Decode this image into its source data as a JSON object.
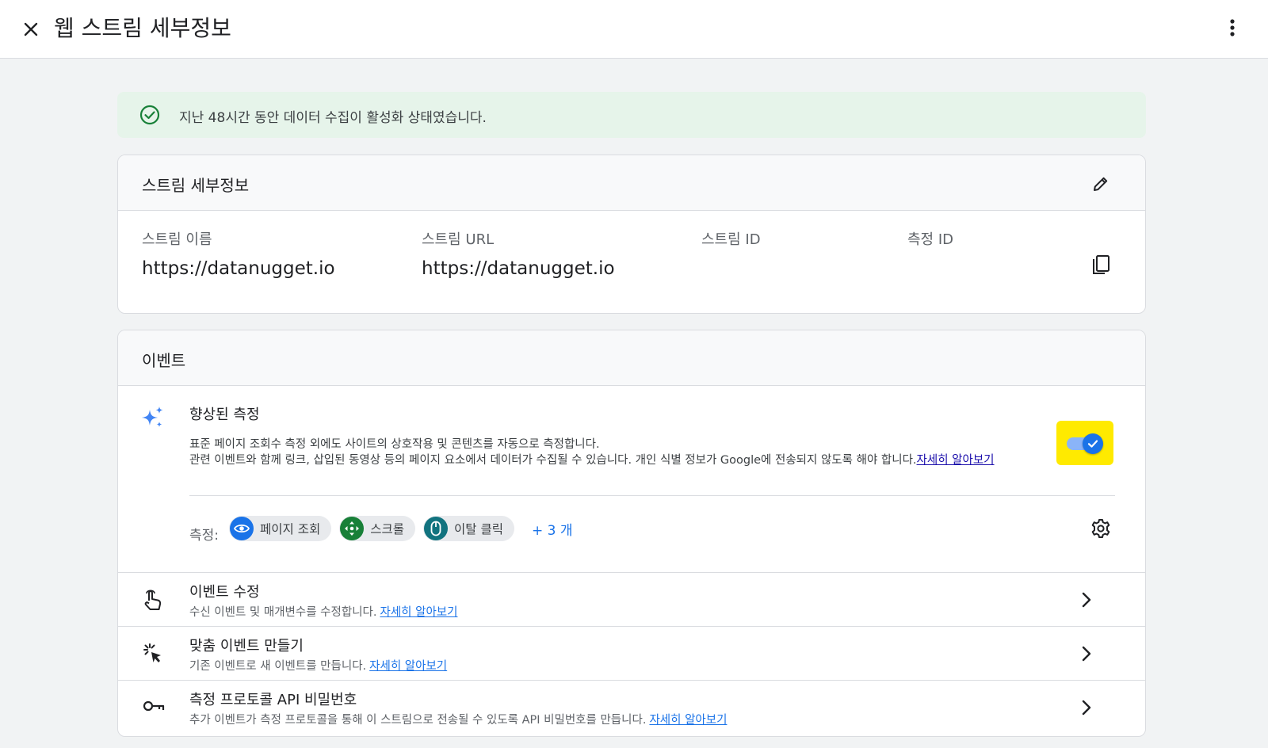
{
  "header": {
    "title": "웹 스트림 세부정보"
  },
  "banner": {
    "text": "지난 48시간 동안 데이터 수집이 활성화 상태였습니다."
  },
  "stream_details": {
    "title": "스트림 세부정보",
    "fields": [
      {
        "label": "스트림 이름",
        "value": "https://datanugget.io"
      },
      {
        "label": "스트림 URL",
        "value": "https://datanugget.io"
      },
      {
        "label": "스트림 ID",
        "value": ""
      },
      {
        "label": "측정 ID",
        "value": ""
      }
    ]
  },
  "events": {
    "title": "이벤트",
    "enhanced": {
      "title": "향상된 측정",
      "desc_line1": "표준 페이지 조회수 측정 외에도 사이트의 상호작용 및 콘텐츠를 자동으로 측정합니다.",
      "desc_line2": "관련 이벤트와 함께 링크, 삽입된 동영상 등의 페이지 요소에서 데이터가 수집될 수 있습니다. 개인 식별 정보가 Google에 전송되지 않도록 해야 합니다.",
      "learn_more": "자세히 알아보기",
      "toggle_on": true,
      "measure_label": "측정:",
      "chips": [
        {
          "label": "페이지 조회",
          "icon": "eye-icon",
          "color": "#1a73e8"
        },
        {
          "label": "스크롤",
          "icon": "scroll-arrows-icon",
          "color": "#188038"
        },
        {
          "label": "이탈 클릭",
          "icon": "mouse-icon",
          "color": "#12737f"
        }
      ],
      "more": "+ 3 개"
    },
    "rows": [
      {
        "title": "이벤트 수정",
        "desc": "수신 이벤트 및 매개변수를 수정합니다.",
        "link": "자세히 알아보기"
      },
      {
        "title": "맞춤 이벤트 만들기",
        "desc": "기존 이벤트로 새 이벤트를 만듭니다.",
        "link": "자세히 알아보기"
      },
      {
        "title": "측정 프로토콜 API 비밀번호",
        "desc": "추가 이벤트가 측정 프로토콜을 통해 이 스트림으로 전송될 수 있도록 API 비밀번호를 만듭니다.",
        "link": "자세히 알아보기"
      }
    ]
  },
  "colors": {
    "accent": "#1a73e8",
    "success": "#188038",
    "highlight": "#ffea00"
  }
}
